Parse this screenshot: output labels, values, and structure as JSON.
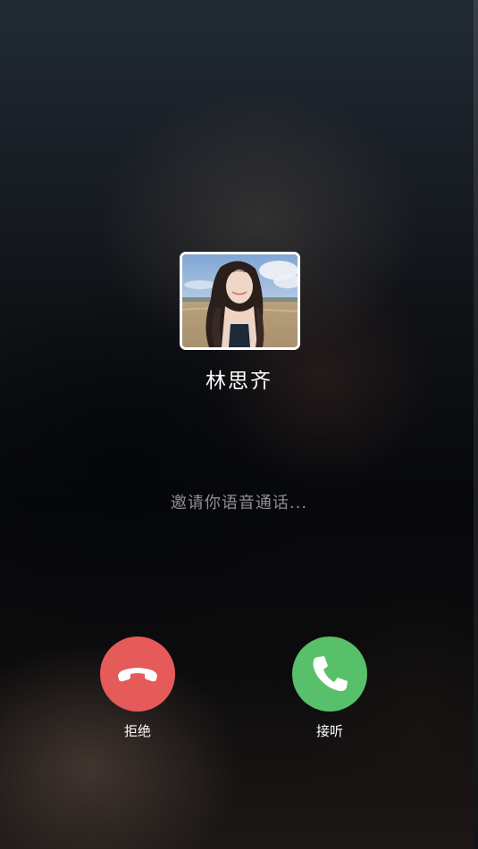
{
  "caller": {
    "name": "林思齐"
  },
  "call": {
    "status": "邀请你语音通话..."
  },
  "actions": {
    "decline": {
      "label": "拒绝",
      "icon": "phone-hangup-icon",
      "color": "#e55b59"
    },
    "accept": {
      "label": "接听",
      "icon": "phone-icon",
      "color": "#58c06a"
    }
  }
}
